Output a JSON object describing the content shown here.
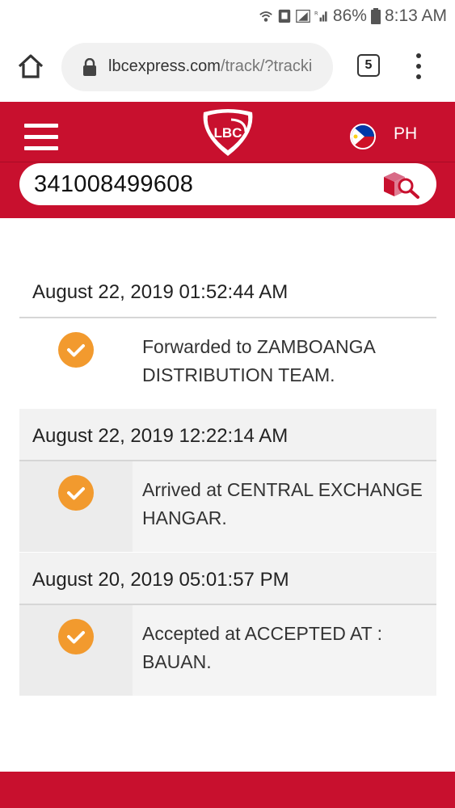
{
  "status_bar": {
    "battery": "86%",
    "time": "8:13 AM",
    "icons": [
      "wifi-calling-icon",
      "notification-icon",
      "signal-icon",
      "roaming-signal-icon",
      "battery-icon"
    ]
  },
  "browser": {
    "url_domain": "lbcexpress.com",
    "url_path": "/track/?tracki",
    "tab_count": "5",
    "icons": [
      "home-icon",
      "lock-icon",
      "overflow-menu-icon"
    ]
  },
  "header": {
    "logo_text": "LBC",
    "country": "PH",
    "colors": {
      "brand": "#c8102e",
      "accent": "#f29a2e"
    }
  },
  "search": {
    "tracking_number": "341008499608"
  },
  "timeline": [
    {
      "date": "August 22, 2019 01:52:44 AM",
      "status": "Forwarded to ZAMBOANGA DISTRIBUTION TEAM."
    },
    {
      "date": "August 22, 2019 12:22:14 AM",
      "status": "Arrived at CENTRAL EXCHANGE HANGAR."
    },
    {
      "date": "August 20, 2019 05:01:57 PM",
      "status": "Accepted at ACCEPTED AT : BAUAN."
    }
  ]
}
